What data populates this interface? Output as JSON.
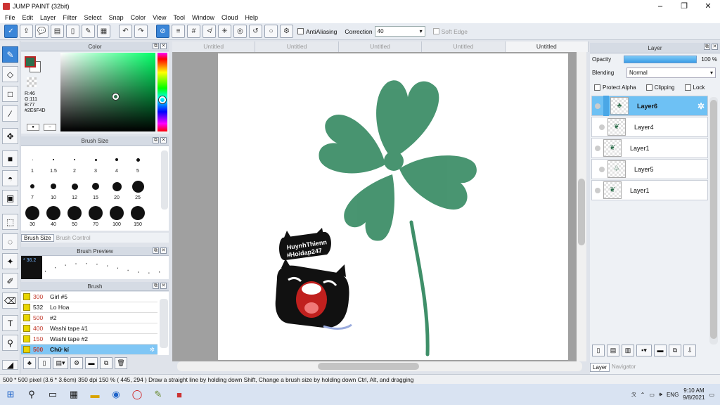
{
  "window": {
    "title": "JUMP PAINT (32bit)",
    "minimize": "–",
    "maximize": "❐",
    "close": "✕"
  },
  "menu": [
    "File",
    "Edit",
    "Layer",
    "Filter",
    "Select",
    "Snap",
    "Color",
    "View",
    "Tool",
    "Window",
    "Cloud",
    "Help"
  ],
  "toolbar": {
    "antialiasing_label": "AntiAliasing",
    "correction_label": "Correction",
    "correction_value": "40",
    "softedge_label": "Soft Edge"
  },
  "color_panel": {
    "title": "Color",
    "r": "R:46",
    "g": "G:111",
    "b": "B:77",
    "hex": "#2E6F4D",
    "current_color": "#2E6F4D"
  },
  "brush_size_panel": {
    "title": "Brush Size",
    "sizes": [
      "1",
      "1.5",
      "2",
      "3",
      "4",
      "5",
      "7",
      "10",
      "12",
      "15",
      "20",
      "25",
      "30",
      "40",
      "50",
      "70",
      "100",
      "150"
    ],
    "tab_active": "Brush Size",
    "tab_inactive": "Brush Control"
  },
  "brush_preview": {
    "title": "Brush Preview",
    "value": "* 36.2"
  },
  "brush_panel": {
    "title": "Brush",
    "items": [
      {
        "size": "300",
        "name": "Girl #5"
      },
      {
        "size": "532",
        "name": "Lo Hoa"
      },
      {
        "size": "500",
        "name": "#2"
      },
      {
        "size": "400",
        "name": "Washi tape #1"
      },
      {
        "size": "150",
        "name": "Washi tape #2"
      },
      {
        "size": "500",
        "name": "Chữ kí"
      }
    ]
  },
  "canvas_tabs": [
    "Untitled",
    "Untitled",
    "Untitled",
    "Untitled",
    "Untitled"
  ],
  "artwork": {
    "sticker_text_1": "HuynhThienn",
    "sticker_text_2": "#Hoidap247",
    "clover_color": "#3f8f69"
  },
  "layer_panel": {
    "title": "Layer",
    "opacity_label": "Opacity",
    "opacity_value": "100 %",
    "blending_label": "Blending",
    "blending_value": "Normal",
    "protect_alpha": "Protect Alpha",
    "clipping": "Clipping",
    "lock": "Lock",
    "layers": [
      "Layer6",
      "Layer4",
      "Layer1",
      "Layer5",
      "Layer1"
    ],
    "tab_active": "Layer",
    "tab_inactive": "Navigator"
  },
  "status": "500 * 500 pixel   (3.6 * 3.6cm)   350 dpi   150 %   ( 445, 294 )   Draw a straight line by holding down Shift, Change a brush size by holding down Ctrl, Alt, and dragging",
  "taskbar": {
    "lang": "ENG",
    "time": "9:10 AM",
    "date": "9/8/2021"
  }
}
